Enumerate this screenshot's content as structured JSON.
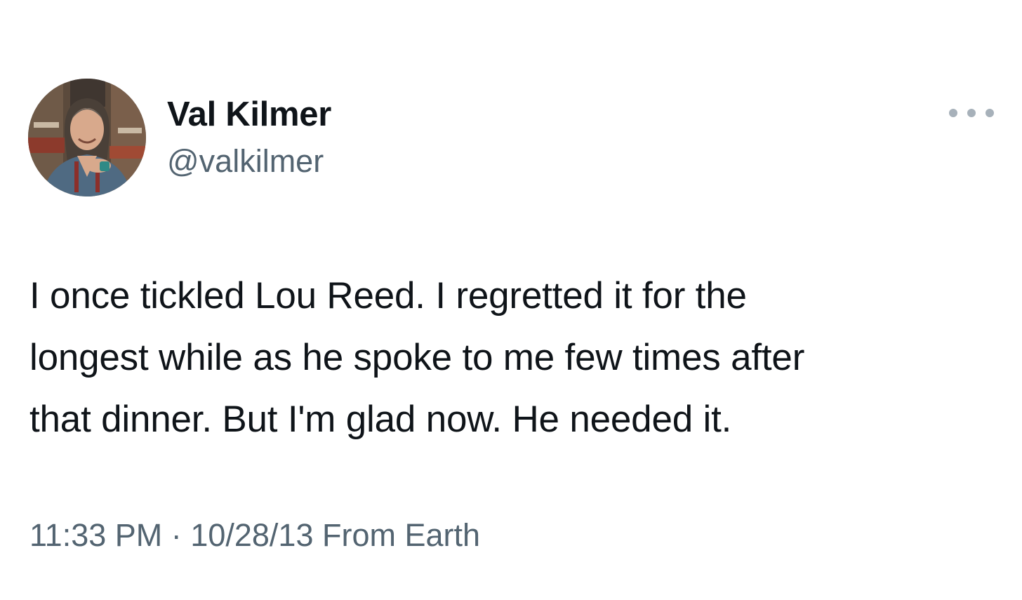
{
  "tweet": {
    "author": {
      "name": "Val Kilmer",
      "handle": "@valkilmer"
    },
    "text": "I once tickled Lou Reed. I regretted it for the\nlongest while as he spoke to me few times after\nthat dinner. But I'm glad now. He needed it.",
    "time": "11:33 PM",
    "separator": "·",
    "date": "10/28/13",
    "source": "From Earth"
  },
  "icons": {
    "more": "more-horizontal-icon",
    "avatar": "profile-photo"
  },
  "colors": {
    "text_primary": "#0f1419",
    "text_secondary": "#536471",
    "background": "#ffffff"
  }
}
